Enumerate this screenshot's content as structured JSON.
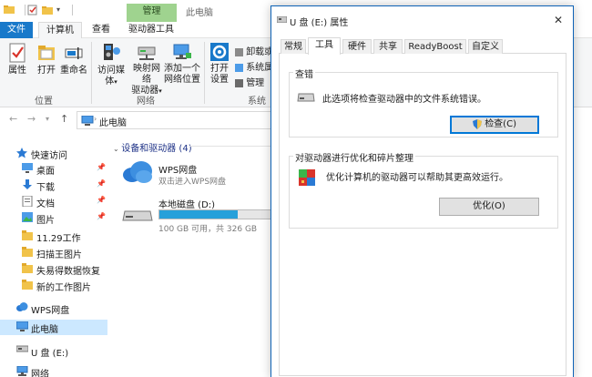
{
  "explorer": {
    "title": "此电脑",
    "contextual_tab": "管理",
    "tabs": [
      "文件",
      "计算机",
      "查看",
      "驱动器工具"
    ]
  },
  "ribbon": {
    "properties": "属性",
    "open": "打开",
    "rename": "重命名",
    "access_media": "访问媒体",
    "map_drive_l1": "映射网络",
    "map_drive_l2": "驱动器",
    "add_location_l1": "添加一个",
    "add_location_l2": "网络位置",
    "open_settings_l1": "打开",
    "open_settings_l2": "设置",
    "uninstall": "卸载或",
    "system_props": "系统属",
    "manage": "管理",
    "group_location": "位置",
    "group_network": "网络",
    "group_system": "系统"
  },
  "address": {
    "path": "此电脑"
  },
  "nav": {
    "quick_access": "快速访问",
    "desktop": "桌面",
    "downloads": "下载",
    "documents": "文档",
    "pictures": "图片",
    "folder1": "11.29工作",
    "folder2": "扫描王图片",
    "folder3": "失易得数据恢复",
    "folder4": "新的工作图片",
    "wps": "WPS网盘",
    "this_pc": "此电脑",
    "usb": "U 盘 (E:)",
    "network": "网络"
  },
  "content": {
    "section": "设备和驱动器 (4)",
    "wps_name": "WPS网盘",
    "wps_sub": "双击进入WPS网盘",
    "disk_name": "本地磁盘 (D:)",
    "disk_free": "100 GB 可用，共 326 GB",
    "disk_used_fraction": 0.69
  },
  "dialog": {
    "title": "U 盘 (E:) 属性",
    "close": "✕",
    "tabs": [
      "常规",
      "工具",
      "硬件",
      "共享",
      "ReadyBoost",
      "自定义"
    ],
    "check_group_title": "查错",
    "check_text": "此选项将检查驱动器中的文件系统错误。",
    "check_button": "检查(C)",
    "optimize_group_title": "对驱动器进行优化和碎片整理",
    "optimize_text": "优化计算机的驱动器可以帮助其更高效运行。",
    "optimize_button": "优化(O)"
  },
  "colors": {
    "file_tab": "#1979ca",
    "contextual_tab": "#9fd38f",
    "selected_nav": "#cce8ff",
    "disk_bar": "#26a0da",
    "dialog_border": "#0d62b6"
  }
}
